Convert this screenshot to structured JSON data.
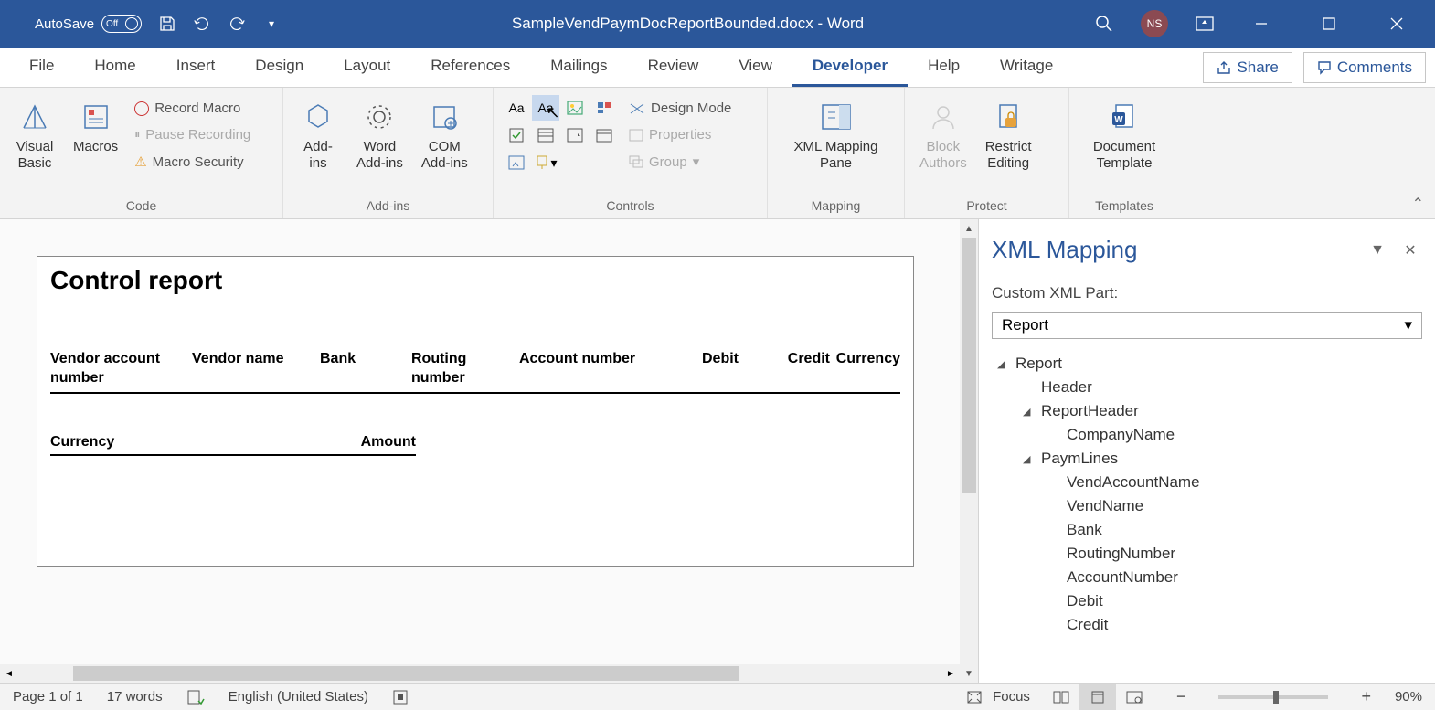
{
  "title_bar": {
    "autosave_label": "AutoSave",
    "autosave_state": "Off",
    "document_title": "SampleVendPaymDocReportBounded.docx - Word",
    "user_initials": "NS"
  },
  "menu_tabs": {
    "file": "File",
    "home": "Home",
    "insert": "Insert",
    "design": "Design",
    "layout": "Layout",
    "references": "References",
    "mailings": "Mailings",
    "review": "Review",
    "view": "View",
    "developer": "Developer",
    "help": "Help",
    "writage": "Writage"
  },
  "menu_actions": {
    "share": "Share",
    "comments": "Comments"
  },
  "ribbon": {
    "code": {
      "label": "Code",
      "visual_basic": "Visual\nBasic",
      "macros": "Macros",
      "record_macro": "Record Macro",
      "pause_recording": "Pause Recording",
      "macro_security": "Macro Security"
    },
    "addins": {
      "label": "Add-ins",
      "addins": "Add-\nins",
      "word_addins": "Word\nAdd-ins",
      "com_addins": "COM\nAdd-ins"
    },
    "controls": {
      "label": "Controls",
      "design_mode": "Design Mode",
      "properties": "Properties",
      "group": "Group"
    },
    "mapping": {
      "label": "Mapping",
      "xml_mapping_pane": "XML Mapping\nPane"
    },
    "protect": {
      "label": "Protect",
      "block_authors": "Block\nAuthors",
      "restrict_editing": "Restrict\nEditing"
    },
    "templates": {
      "label": "Templates",
      "document_template": "Document\nTemplate"
    }
  },
  "document": {
    "heading": "Control report",
    "columns": {
      "vendor_account_number": "Vendor account number",
      "vendor_name": "Vendor name",
      "bank": "Bank",
      "routing_number": "Routing number",
      "account_number": "Account number",
      "debit": "Debit",
      "credit": "Credit",
      "currency": "Currency"
    },
    "sub_columns": {
      "currency": "Currency",
      "amount": "Amount"
    }
  },
  "xml_pane": {
    "title": "XML Mapping",
    "custom_part_label": "Custom XML Part:",
    "selected_part": "Report",
    "tree": {
      "root": "Report",
      "items": [
        {
          "label": "Header",
          "level": 1,
          "expandable": false
        },
        {
          "label": "ReportHeader",
          "level": 1,
          "expandable": true
        },
        {
          "label": "CompanyName",
          "level": 2,
          "expandable": false
        },
        {
          "label": "PaymLines",
          "level": 1,
          "expandable": true
        },
        {
          "label": "VendAccountName",
          "level": 2,
          "expandable": false
        },
        {
          "label": "VendName",
          "level": 2,
          "expandable": false
        },
        {
          "label": "Bank",
          "level": 2,
          "expandable": false
        },
        {
          "label": "RoutingNumber",
          "level": 2,
          "expandable": false
        },
        {
          "label": "AccountNumber",
          "level": 2,
          "expandable": false
        },
        {
          "label": "Debit",
          "level": 2,
          "expandable": false
        },
        {
          "label": "Credit",
          "level": 2,
          "expandable": false
        }
      ]
    }
  },
  "status_bar": {
    "page_info": "Page 1 of 1",
    "word_count": "17 words",
    "language": "English (United States)",
    "focus": "Focus",
    "zoom": "90%"
  }
}
